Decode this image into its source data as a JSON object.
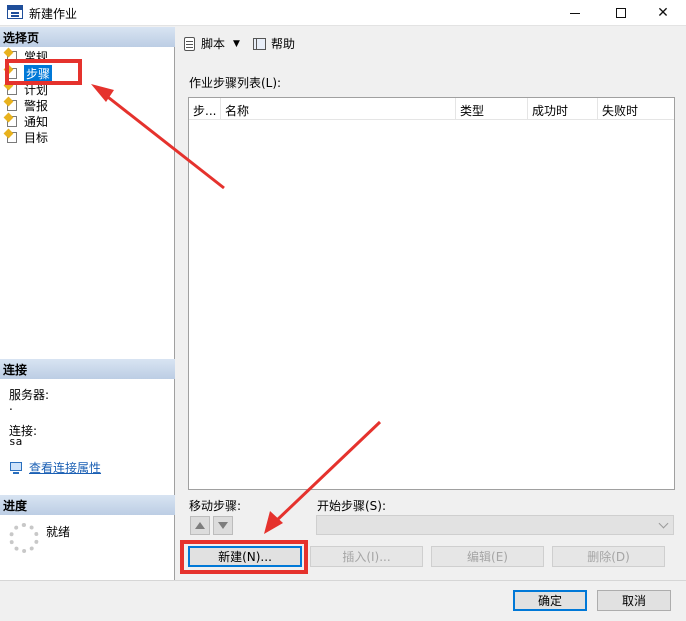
{
  "window": {
    "title": "新建作业"
  },
  "sidebar": {
    "select_page_header": "选择页",
    "items": [
      {
        "label": "常规"
      },
      {
        "label": "步骤"
      },
      {
        "label": "计划"
      },
      {
        "label": "警报"
      },
      {
        "label": "通知"
      },
      {
        "label": "目标"
      }
    ],
    "selected_index": 1,
    "connection": {
      "header": "连接",
      "server_label": "服务器:",
      "server_value": ".",
      "connection_label": "连接:",
      "connection_value": "sa",
      "view_properties_link": "查看连接属性"
    },
    "progress": {
      "header": "进度",
      "status": "就绪"
    }
  },
  "toolbar": {
    "script_label": "脚本",
    "help_label": "帮助"
  },
  "steps": {
    "list_label": "作业步骤列表(L):",
    "columns": [
      "步...",
      "名称",
      "类型",
      "成功时",
      "失败时"
    ],
    "rows": [],
    "move_step_label": "移动步骤:",
    "start_step_label": "开始步骤(S):",
    "start_step_value": "",
    "buttons": {
      "new": "新建(N)...",
      "insert": "插入(I)...",
      "edit": "编辑(E)",
      "delete": "删除(D)"
    }
  },
  "footer": {
    "ok": "确定",
    "cancel": "取消"
  },
  "colors": {
    "annotation": "#e5322d",
    "selection": "#0078d7",
    "header_gradient_top": "#d8e4f2",
    "header_gradient_bottom": "#bccde4"
  }
}
